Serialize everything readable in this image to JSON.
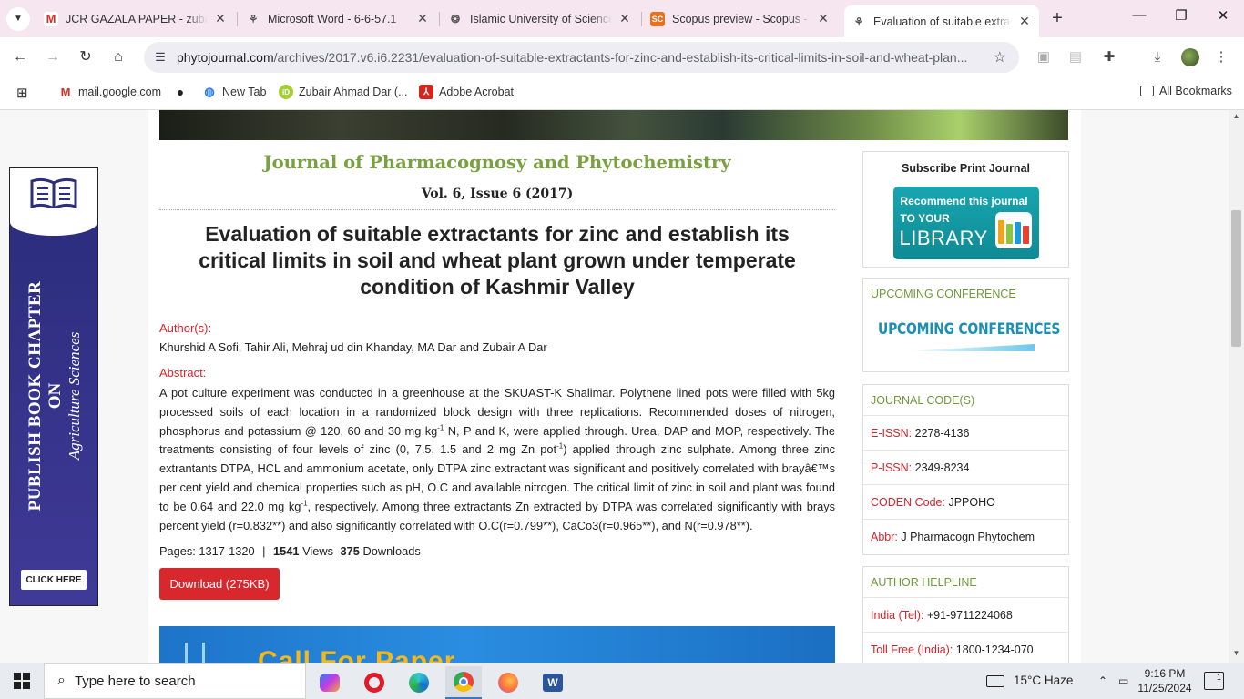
{
  "browser": {
    "tabs": [
      {
        "title": "JCR GAZALA PAPER - zubair",
        "icon": "gmail-icon",
        "active": false
      },
      {
        "title": "Microsoft Word - 6-6-57.1",
        "icon": "extension-icon",
        "active": false
      },
      {
        "title": "Islamic University of Science",
        "icon": "university-icon",
        "active": false
      },
      {
        "title": "Scopus preview - Scopus - S",
        "icon": "scopus-icon",
        "favicon_text": "SC",
        "active": false
      },
      {
        "title": "Evaluation of suitable extract",
        "icon": "extension-icon",
        "active": true
      }
    ],
    "url_domain": "phytojournal.com",
    "url_path": "/archives/2017.v6.i6.2231/evaluation-of-suitable-extractants-for-zinc-and-establish-its-critical-limits-in-soil-and-wheat-plan...",
    "bookmarks": [
      {
        "label": "mail.google.com",
        "icon": "gmail-icon"
      },
      {
        "label": "",
        "icon": "globe-icon"
      },
      {
        "label": "New Tab",
        "icon": "newtab-icon"
      },
      {
        "label": "Zubair Ahmad Dar (...",
        "icon": "orcid-icon",
        "favicon_text": "iD"
      },
      {
        "label": "Adobe Acrobat",
        "icon": "acrobat-icon"
      }
    ],
    "all_bookmarks": "All Bookmarks"
  },
  "page": {
    "journal_title": "Journal of Pharmacognosy and Phytochemistry",
    "volume": "Vol. 6, Issue 6 (2017)",
    "article_title": "Evaluation of suitable extractants for zinc and establish its critical limits in soil and wheat plant grown under temperate condition of Kashmir Valley",
    "authors_label": "Author(s):",
    "authors": "Khurshid A Sofi, Tahir Ali, Mehraj ud din Khanday, MA Dar and Zubair A Dar",
    "abstract_label": "Abstract:",
    "abstract_parts": {
      "p1": "A pot culture experiment was conducted in a greenhouse at the SKUAST-K Shalimar. Polythene lined pots were filled with 5kg processed soils of each location in a randomized block design with three replications. Recommended doses of nitrogen, phosphorus and potassium @ 120, 60 and 30 mg kg",
      "sup1": "-1",
      "p2": " N, P and K, were applied through. Urea, DAP and MOP, respectively. The treatments consisting of four levels of zinc (0, 7.5, 1.5 and 2 mg Zn pot",
      "sup2": "-1",
      "p3": ") applied through zinc sulphate. Among three zinc extrantants DTPA, HCL and ammonium acetate, only DTPA zinc extractant was significant and positively correlated with brayâ€™s per cent yield and chemical properties such as pH, O.C and available nitrogen. The critical limit of zinc in soil and plant was found to be 0.64 and 22.0 mg kg",
      "sup3": "-1",
      "p4": ", respectively. Among three extractants Zn extracted by DTPA was correlated significantly with brays percent yield (r=0.832**) and also significantly correlated with O.C(r=0.799**), CaCo3(r=0.965**), and N(r=0.978**)."
    },
    "pages": "Pages: 1317-1320",
    "separator": "|",
    "views_count": "1541",
    "views_label": "Views",
    "downloads_count": "375",
    "downloads_label": "Downloads",
    "download_button": "Download (275KB)",
    "call_for_paper": "Call For Paper"
  },
  "sidebar": {
    "subscribe_title": "Subscribe Print Journal",
    "library_badge": {
      "line1": "Recommend this journal",
      "line2": "TO YOUR",
      "line3": "LIBRARY"
    },
    "upcoming_head": "UPCOMING CONFERENCE",
    "upcoming_banner": "UPCOMING CONFERENCES",
    "codes_head": "JOURNAL CODE(S)",
    "codes": [
      {
        "key": "E-ISSN:",
        "value": "2278-4136"
      },
      {
        "key": "P-ISSN:",
        "value": "2349-8234"
      },
      {
        "key": "CODEN Code:",
        "value": "JPPOHO"
      },
      {
        "key": "Abbr:",
        "value": "J Pharmacogn Phytochem"
      }
    ],
    "helpline_head": "AUTHOR HELPLINE",
    "helpline": [
      {
        "key": "India (Tel):",
        "value": "+91-9711224068"
      },
      {
        "key": "Toll Free (India):",
        "value": "1800-1234-070"
      }
    ]
  },
  "left_ad": {
    "line1": "PUBLISH BOOK CHAPTER",
    "line2": "ON",
    "line3": "Agriculture Sciences",
    "cta": "CLICK HERE"
  },
  "taskbar": {
    "search_placeholder": "Type here to search",
    "weather": "15°C  Haze",
    "time": "9:16 PM",
    "date": "11/25/2024",
    "notifications": "1"
  },
  "colors": {
    "journal_green": "#7aa140",
    "label_red": "#d7232a",
    "download_red": "#d9272e",
    "sidebar_green": "#6f9a3a",
    "tabbar_bg": "#f5e6f0"
  }
}
